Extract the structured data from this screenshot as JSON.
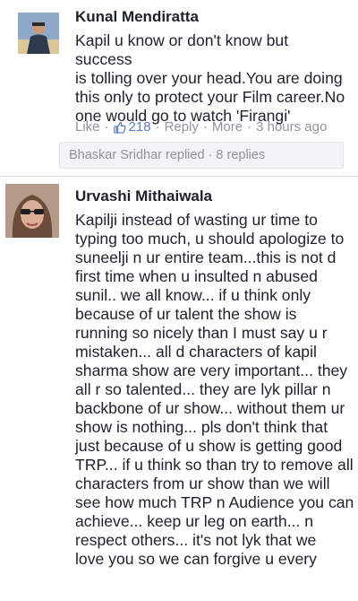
{
  "comments": [
    {
      "author": "Kunal Mendiratta",
      "text": "Kapil u know or don't know but success\nis tolling over your head.You are doing\nthis only to protect your Film career.No\none would go to watch 'Firangi'",
      "like_label": "Like",
      "like_count": "218",
      "reply_label": "Reply",
      "more_label": "More",
      "timestamp": "3 hours ago",
      "replies_summary": "Bhaskar Sridhar replied · 8 replies"
    },
    {
      "author": "Urvashi Mithaiwala",
      "text": "Kapilji instead of wasting ur time to\ntyping too much, u should apologize to\nsuneelji n ur entire team...this is not d\nfirst time when u insulted n abused\nsunil.. we all know... if u think only\nbecause of ur talent the show is\nrunning so nicely than I must say u r\nmistaken... all d characters of kapil\nsharma show are very important... they\nall r so talented... they are lyk pillar n\nbackbone of ur show... without them ur\nshow is nothing... pls don't think that\njust because of u show is getting good\nTRP... if u think so than try to remove all\ncharacters from ur show than we will\nsee how much TRP n Audience you can\nachieve... keep ur leg on earth... n\nrespect others... it's not lyk that we\nlove you so we can forgive u every"
    }
  ],
  "colors": {
    "link": "#5f7fbf",
    "meta": "#90949c",
    "text": "#1d2129"
  },
  "icons": {
    "like_icon": "thumbs-up-icon"
  }
}
